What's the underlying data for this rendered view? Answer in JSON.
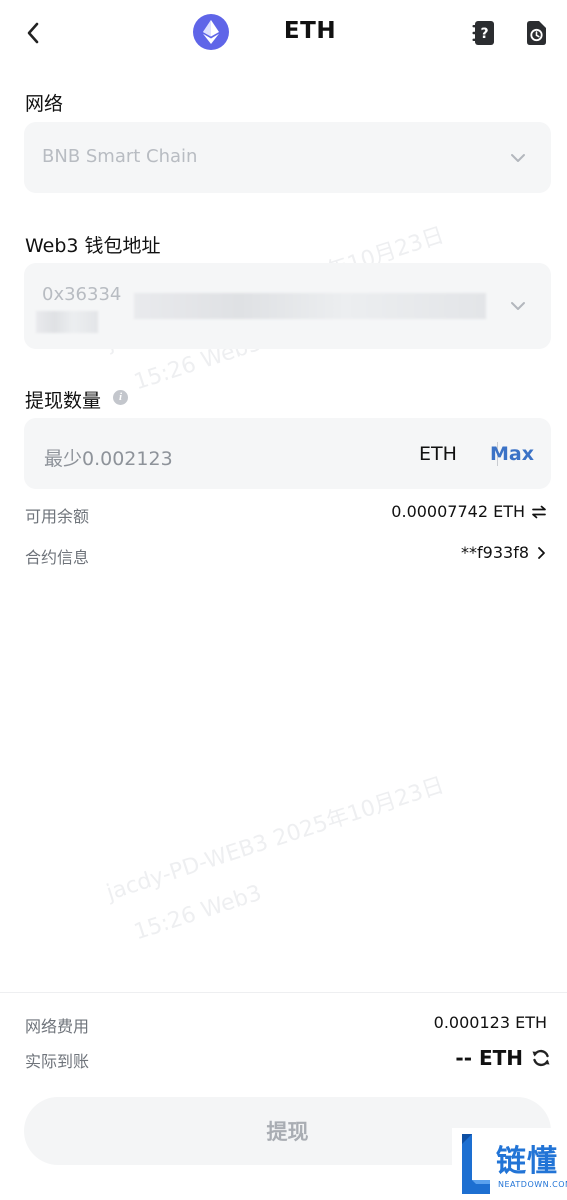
{
  "header": {
    "title": "ETH",
    "back_icon": "chevron-left-icon",
    "coin_icon": "ethereum-icon",
    "help_icon": "help-book-icon",
    "record_icon": "history-record-icon",
    "coin_color": "#5f65e8"
  },
  "network": {
    "label": "网络",
    "value": "BNB Smart Chain"
  },
  "address": {
    "label": "Web3 钱包地址",
    "value": "0x36334"
  },
  "amount": {
    "label": "提现数量",
    "placeholder": "最少0.002123",
    "unit": "ETH",
    "max_label": "Max"
  },
  "balance": {
    "label": "可用余额",
    "value": "0.00007742 ETH"
  },
  "contract": {
    "label": "合约信息",
    "value": "**f933f8"
  },
  "fee": {
    "label": "网络费用",
    "value": "0.000123 ETH"
  },
  "receive": {
    "label": "实际到账",
    "value": "-- ETH"
  },
  "submit": {
    "label": "提现"
  },
  "watermarks": [
    {
      "line1": "jacdy-PD-WEB3 2025年10月23日",
      "line2": "15:26 Web3"
    },
    {
      "line1": "jacdy-PD-WEB3 2025年10月23日",
      "line2": "15:26 Web3"
    }
  ],
  "brand": {
    "name": "链懂",
    "sub": "NEATDOWN.COM"
  },
  "colors": {
    "accent": "#3b72c6",
    "brand": "#2274d6"
  }
}
